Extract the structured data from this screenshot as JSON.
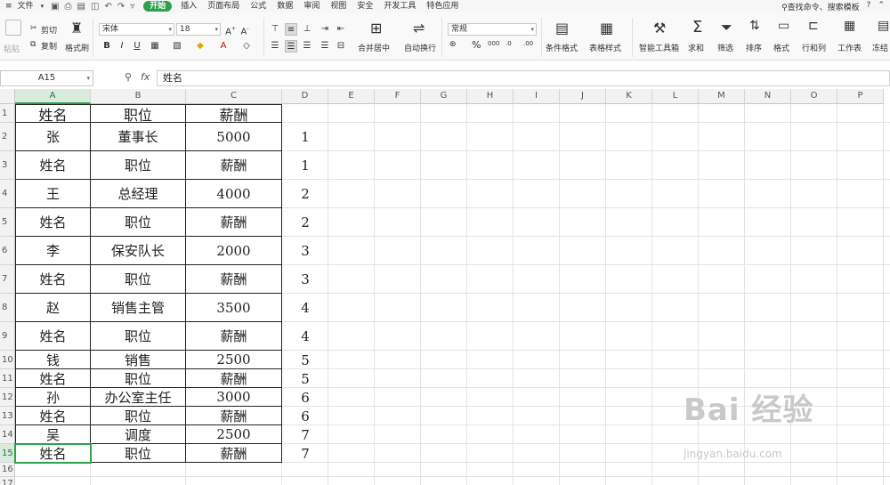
{
  "menubar": {
    "menu_icon": "≡",
    "file": "文件",
    "tabs": [
      "插入",
      "页面布局",
      "公式",
      "数据",
      "审阅",
      "视图",
      "安全",
      "开发工具",
      "特色应用"
    ],
    "active_tab": "开始",
    "search": "查找命令、搜索模板",
    "help": "?"
  },
  "ribbon": {
    "paste": "粘贴",
    "cut": "剪切",
    "copy": "复制",
    "format_painter": "格式刷",
    "font_name": "宋体",
    "font_size": "18",
    "merge_center": "合并居中",
    "wrap_text": "自动换行",
    "number_format": "常规",
    "cond_format": "条件格式",
    "table_style": "表格样式",
    "smart_toolbox": "智能工具箱",
    "sum": "求和",
    "filter": "筛选",
    "sort": "排序",
    "format": "格式",
    "row_col": "行和列",
    "worksheet": "工作表",
    "freeze": "冻结"
  },
  "formula_bar": {
    "name_box": "A15",
    "fx": "fx",
    "content": "姓名"
  },
  "grid": {
    "columns": [
      "A",
      "B",
      "C",
      "D",
      "E",
      "F",
      "G",
      "H",
      "I",
      "J",
      "K",
      "L",
      "M",
      "N",
      "O",
      "P"
    ],
    "row_numbers": [
      "1",
      "2",
      "3",
      "4",
      "5",
      "6",
      "7",
      "8",
      "9",
      "10",
      "11",
      "12",
      "13",
      "14",
      "15",
      "16",
      "17"
    ],
    "active_cell": "A15",
    "rows": [
      [
        "姓名",
        "职位",
        "薪酬",
        ""
      ],
      [
        "张",
        "董事长",
        "5000",
        "1"
      ],
      [
        "姓名",
        "职位",
        "薪酬",
        "1"
      ],
      [
        "王",
        "总经理",
        "4000",
        "2"
      ],
      [
        "姓名",
        "职位",
        "薪酬",
        "2"
      ],
      [
        "李",
        "保安队长",
        "2000",
        "3"
      ],
      [
        "姓名",
        "职位",
        "薪酬",
        "3"
      ],
      [
        "赵",
        "销售主管",
        "3500",
        "4"
      ],
      [
        "姓名",
        "职位",
        "薪酬",
        "4"
      ],
      [
        "钱",
        "销售",
        "2500",
        "5"
      ],
      [
        "姓名",
        "职位",
        "薪酬",
        "5"
      ],
      [
        "孙",
        "办公室主任",
        "3000",
        "6"
      ],
      [
        "姓名",
        "职位",
        "薪酬",
        "6"
      ],
      [
        "吴",
        "调度",
        "2500",
        "7"
      ],
      [
        "姓名",
        "职位",
        "薪酬",
        "7"
      ]
    ]
  },
  "watermark": {
    "logo": "Bai 经验",
    "url": "jingyan.baidu.com"
  }
}
